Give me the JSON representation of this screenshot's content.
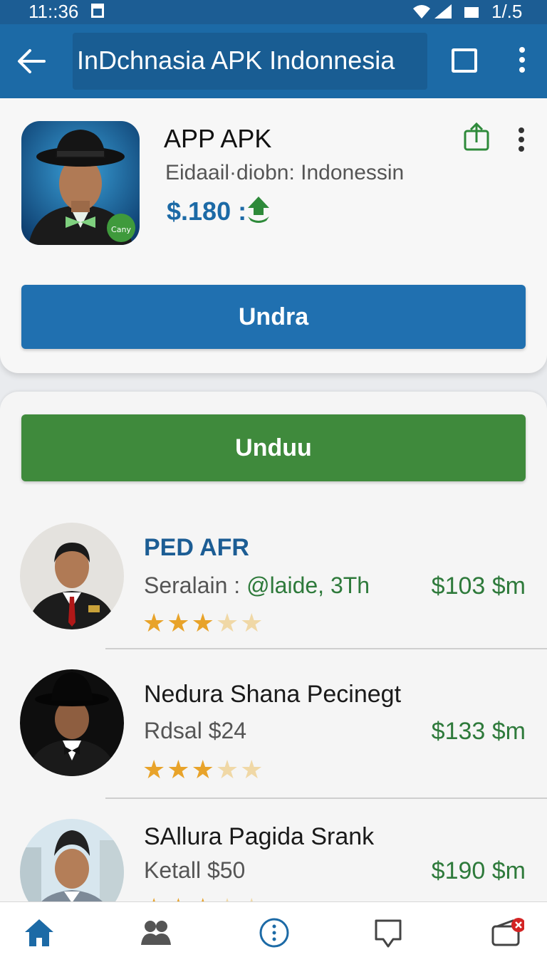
{
  "status_bar": {
    "time": "11::36",
    "battery_text": "1/.5"
  },
  "app_bar": {
    "title": "InDchnasia APK Indonnesia"
  },
  "app_card": {
    "name": "APP APK",
    "subtitle": "Eidaail·diobn: Indonessin",
    "price": "$.180 :",
    "badge_text": "Cany",
    "primary_button": "Undra"
  },
  "list": {
    "download_button": "Unduu",
    "items": [
      {
        "name": "PED AFR",
        "sub_prefix": "Seralain : ",
        "sub_highlight": "@laide, 3Th",
        "price": "$103 $m",
        "rating": 3
      },
      {
        "name": "Nedura Shana Pecinegt",
        "sub_prefix": "Rdsal $24",
        "sub_highlight": "",
        "price": "$133 $m",
        "rating": 3
      },
      {
        "name": "SAllura Pagida Srank",
        "sub_prefix": "Ketall $50",
        "sub_highlight": "",
        "price": "$190 $m",
        "rating": 3
      }
    ]
  },
  "bottom_nav": [
    "home-icon",
    "people-icon",
    "info-icon",
    "chat-icon",
    "wallet-icon"
  ],
  "colors": {
    "primary": "#1c6aa6",
    "green": "#3f8a3c",
    "price_green": "#2e7a3b",
    "star": "#e8a32a"
  }
}
